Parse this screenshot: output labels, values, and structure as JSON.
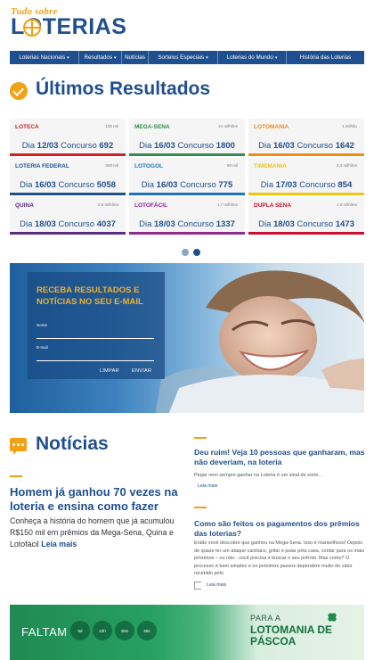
{
  "header": {
    "logo_top": "Tudo sobre",
    "logo_main": "LOTERIAS"
  },
  "nav": {
    "items": [
      {
        "label": "Loterias Nacionais",
        "dropdown": true
      },
      {
        "label": "Resultados",
        "dropdown": true
      },
      {
        "label": "Notícias",
        "dropdown": false
      },
      {
        "label": "Sorteios Especiais",
        "dropdown": true
      },
      {
        "label": "Loterias do Mundo",
        "dropdown": true
      },
      {
        "label": "História das Loterias",
        "dropdown": false
      }
    ]
  },
  "results": {
    "title": "Últimos Resultados",
    "cards": [
      {
        "name": "LOTECA",
        "prize": "100 mil",
        "day_label": "Dia",
        "date": "12/03",
        "contest_label": "Concurso",
        "contest": "692",
        "color": "#d22027"
      },
      {
        "name": "MEGA-SENA",
        "prize": "21 milhões",
        "day_label": "Dia",
        "date": "16/03",
        "contest_label": "Concurso",
        "contest": "1800",
        "color": "#2f8f4e"
      },
      {
        "name": "LOTOMANIA",
        "prize": "1 milhão",
        "day_label": "Dia",
        "date": "16/03",
        "contest_label": "Concurso",
        "contest": "1642",
        "color": "#f08c16"
      },
      {
        "name": "LOTERIA FEDERAL",
        "prize": "300 mil",
        "day_label": "Dia",
        "date": "16/03",
        "contest_label": "Concurso",
        "contest": "5058",
        "color": "#1f4f8e"
      },
      {
        "name": "LOTOGOL",
        "prize": "60 mil",
        "day_label": "Dia",
        "date": "16/03",
        "contest_label": "Concurso",
        "contest": "775",
        "color": "#1e73be"
      },
      {
        "name": "TIMEMANIA",
        "prize": "2,4 milhões",
        "day_label": "Dia",
        "date": "17/03",
        "contest_label": "Concurso",
        "contest": "854",
        "color": "#f2c514"
      },
      {
        "name": "QUINA",
        "prize": "2,6 milhões",
        "day_label": "Dia",
        "date": "18/03",
        "contest_label": "Concurso",
        "contest": "4037",
        "color": "#5b2c83"
      },
      {
        "name": "LOTOFÁCIL",
        "prize": "1,7 milhões",
        "day_label": "Dia",
        "date": "18/03",
        "contest_label": "Concurso",
        "contest": "1337",
        "color": "#93278f"
      },
      {
        "name": "DUPLA SENA",
        "prize": "1,6 milhões",
        "day_label": "Dia",
        "date": "18/03",
        "contest_label": "Concurso",
        "contest": "1473",
        "color": "#c8102e"
      }
    ],
    "carousel_pages": 2,
    "carousel_active": 2
  },
  "signup": {
    "title": "RECEBA RESULTADOS E NOTÍCIAS NO SEU E-MAIL",
    "name_label": "Nome",
    "email_label": "E-mail",
    "clear_label": "LIMPAR",
    "send_label": "ENVIAR"
  },
  "news": {
    "title": "Notícias",
    "lead": {
      "title": "Homem já ganhou 70 vezes na loteria e ensina como fazer",
      "text": "Conheça a história do homem que já acumulou R$150 mil em prêmios da Mega-Sena, Quina e Lotofácil",
      "read_more": "Leia mais"
    },
    "side": [
      {
        "title": "Deu ruim! Veja 10 pessoas que ganharam, mas não deveriam, na loteria",
        "text": "Pegar nem sempre ganhar na Loteria é um sinal de sorte...",
        "read_more": "Leia mais"
      },
      {
        "title": "Como são feitos os pagamentos dos prêmios das loterias?",
        "text": "Então você descobre que ganhou na Mega-Sena. Isso é maravilhoso! Depois de quase ter um ataque cardíaco, gritar e pular pela casa, contar para os mais próximos – ou não - você precisa ir buscar o seu prêmio. Mas como? O processo é bem simples e os próximos passos dependem muito do valor recebido pelo",
        "read_more": "Leia mais"
      }
    ]
  },
  "countdown": {
    "label": "FALTAM",
    "units": [
      "6d",
      "23h",
      "35m",
      "59s"
    ],
    "pre_title": "PARA A",
    "game": "LOTOMANIA DE PÁSCOA"
  },
  "colors": {
    "brand_blue": "#1f4f8e",
    "accent_orange": "#f0a116",
    "countdown_green": "#1f8a52"
  }
}
